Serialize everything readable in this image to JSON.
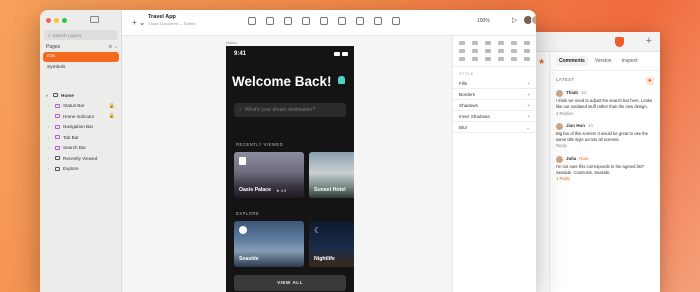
{
  "app": {
    "title": "Travel App",
    "subtitle": "Cloud Document — Edited",
    "zoom": "100%",
    "search_placeholder": "Search Layers",
    "pages_label": "Pages",
    "pages": [
      "iOS",
      "Symbols"
    ],
    "layers": [
      {
        "label": "Home",
        "lock": false
      },
      {
        "label": "Status Bar",
        "lock": true
      },
      {
        "label": "Home Indicator",
        "lock": true
      },
      {
        "label": "Navigation Bar",
        "lock": false
      },
      {
        "label": "Tab Bar",
        "lock": false
      },
      {
        "label": "Search Bar",
        "lock": false
      },
      {
        "label": "Recently Viewed",
        "lock": false
      },
      {
        "label": "Explore",
        "lock": false
      }
    ]
  },
  "canvas": {
    "frame_label": "Home",
    "phone": {
      "time": "9:41",
      "welcome": "Welcome Back!",
      "search_placeholder": "What's your dream destination?",
      "recent_label": "RECENTLY VIEWED",
      "explore_label": "EXPLORE",
      "cards": [
        {
          "name": "Oasis Palace",
          "rating": "★ 4.9"
        },
        {
          "name": "Sunset Hotel",
          "rating": ""
        },
        {
          "name": "Seaside",
          "rating": ""
        },
        {
          "name": "Nightlife",
          "rating": ""
        }
      ],
      "view_all": "VIEW ALL"
    }
  },
  "inspector": {
    "style_label": "STYLE",
    "rows": [
      "Fills",
      "Borders",
      "Shadows",
      "Inner Shadows",
      "Blur"
    ]
  },
  "browser": {
    "tabs": [
      "Comments",
      "Version",
      "Inspect"
    ],
    "latest_label": "LATEST",
    "comments": [
      {
        "author": "Thiab",
        "time": "2d",
        "text": "I think we need to adjust the search bar here. Looks like our outdated stuff rather than the new design.",
        "meta": "4 Replies"
      },
      {
        "author": "Jian Hun",
        "time": "1h",
        "text": "Big fan of this screen! It would be great to use the same title style across all screens.",
        "meta": "Reply"
      },
      {
        "author": "Julia",
        "time": "Now",
        "text": "I'm not sure this corresponds to the agreed list? Seaside, Cosmosis. Seaside.",
        "meta": "1 Reply"
      }
    ]
  },
  "colors": {
    "accent": "#f46b1f",
    "background": "#f48a4a"
  }
}
